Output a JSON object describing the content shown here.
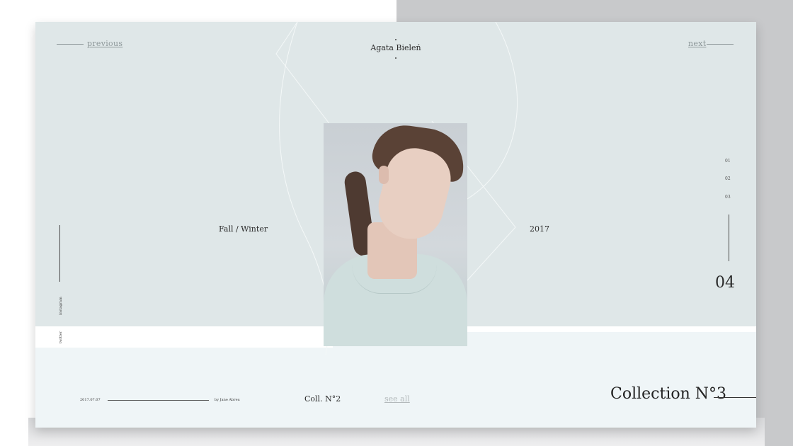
{
  "nav": {
    "previous": "previous",
    "next": "next"
  },
  "header": {
    "author": "Agata Bieleń"
  },
  "hero": {
    "season": "Fall / Winter",
    "year": "2017"
  },
  "sidebar_left": {
    "label_1": "instagram",
    "label_2": "twitter"
  },
  "slider": {
    "indices": [
      "01",
      "02",
      "03"
    ],
    "current": "04"
  },
  "footer": {
    "date": "2017.07.07",
    "byline": "by Jane Abreu",
    "collection_small": "Coll. N°2",
    "see_all": "see all",
    "collection_title": "Collection N°3"
  },
  "colors": {
    "card": "#dfe7e8",
    "card_bottom": "#eff5f7",
    "outer_right": "#c8c9cb",
    "muted_link": "#b3b9bb"
  }
}
